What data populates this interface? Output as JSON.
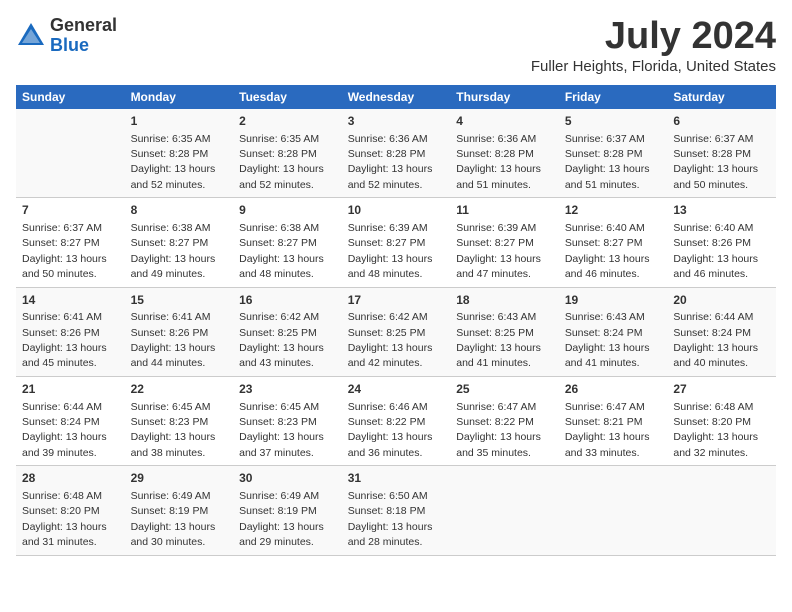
{
  "logo": {
    "general": "General",
    "blue": "Blue"
  },
  "title": "July 2024",
  "location": "Fuller Heights, Florida, United States",
  "days_header": [
    "Sunday",
    "Monday",
    "Tuesday",
    "Wednesday",
    "Thursday",
    "Friday",
    "Saturday"
  ],
  "weeks": [
    [
      {
        "num": "",
        "sunrise": "",
        "sunset": "",
        "daylight": ""
      },
      {
        "num": "1",
        "sunrise": "Sunrise: 6:35 AM",
        "sunset": "Sunset: 8:28 PM",
        "daylight": "Daylight: 13 hours and 52 minutes."
      },
      {
        "num": "2",
        "sunrise": "Sunrise: 6:35 AM",
        "sunset": "Sunset: 8:28 PM",
        "daylight": "Daylight: 13 hours and 52 minutes."
      },
      {
        "num": "3",
        "sunrise": "Sunrise: 6:36 AM",
        "sunset": "Sunset: 8:28 PM",
        "daylight": "Daylight: 13 hours and 52 minutes."
      },
      {
        "num": "4",
        "sunrise": "Sunrise: 6:36 AM",
        "sunset": "Sunset: 8:28 PM",
        "daylight": "Daylight: 13 hours and 51 minutes."
      },
      {
        "num": "5",
        "sunrise": "Sunrise: 6:37 AM",
        "sunset": "Sunset: 8:28 PM",
        "daylight": "Daylight: 13 hours and 51 minutes."
      },
      {
        "num": "6",
        "sunrise": "Sunrise: 6:37 AM",
        "sunset": "Sunset: 8:28 PM",
        "daylight": "Daylight: 13 hours and 50 minutes."
      }
    ],
    [
      {
        "num": "7",
        "sunrise": "Sunrise: 6:37 AM",
        "sunset": "Sunset: 8:27 PM",
        "daylight": "Daylight: 13 hours and 50 minutes."
      },
      {
        "num": "8",
        "sunrise": "Sunrise: 6:38 AM",
        "sunset": "Sunset: 8:27 PM",
        "daylight": "Daylight: 13 hours and 49 minutes."
      },
      {
        "num": "9",
        "sunrise": "Sunrise: 6:38 AM",
        "sunset": "Sunset: 8:27 PM",
        "daylight": "Daylight: 13 hours and 48 minutes."
      },
      {
        "num": "10",
        "sunrise": "Sunrise: 6:39 AM",
        "sunset": "Sunset: 8:27 PM",
        "daylight": "Daylight: 13 hours and 48 minutes."
      },
      {
        "num": "11",
        "sunrise": "Sunrise: 6:39 AM",
        "sunset": "Sunset: 8:27 PM",
        "daylight": "Daylight: 13 hours and 47 minutes."
      },
      {
        "num": "12",
        "sunrise": "Sunrise: 6:40 AM",
        "sunset": "Sunset: 8:27 PM",
        "daylight": "Daylight: 13 hours and 46 minutes."
      },
      {
        "num": "13",
        "sunrise": "Sunrise: 6:40 AM",
        "sunset": "Sunset: 8:26 PM",
        "daylight": "Daylight: 13 hours and 46 minutes."
      }
    ],
    [
      {
        "num": "14",
        "sunrise": "Sunrise: 6:41 AM",
        "sunset": "Sunset: 8:26 PM",
        "daylight": "Daylight: 13 hours and 45 minutes."
      },
      {
        "num": "15",
        "sunrise": "Sunrise: 6:41 AM",
        "sunset": "Sunset: 8:26 PM",
        "daylight": "Daylight: 13 hours and 44 minutes."
      },
      {
        "num": "16",
        "sunrise": "Sunrise: 6:42 AM",
        "sunset": "Sunset: 8:25 PM",
        "daylight": "Daylight: 13 hours and 43 minutes."
      },
      {
        "num": "17",
        "sunrise": "Sunrise: 6:42 AM",
        "sunset": "Sunset: 8:25 PM",
        "daylight": "Daylight: 13 hours and 42 minutes."
      },
      {
        "num": "18",
        "sunrise": "Sunrise: 6:43 AM",
        "sunset": "Sunset: 8:25 PM",
        "daylight": "Daylight: 13 hours and 41 minutes."
      },
      {
        "num": "19",
        "sunrise": "Sunrise: 6:43 AM",
        "sunset": "Sunset: 8:24 PM",
        "daylight": "Daylight: 13 hours and 41 minutes."
      },
      {
        "num": "20",
        "sunrise": "Sunrise: 6:44 AM",
        "sunset": "Sunset: 8:24 PM",
        "daylight": "Daylight: 13 hours and 40 minutes."
      }
    ],
    [
      {
        "num": "21",
        "sunrise": "Sunrise: 6:44 AM",
        "sunset": "Sunset: 8:24 PM",
        "daylight": "Daylight: 13 hours and 39 minutes."
      },
      {
        "num": "22",
        "sunrise": "Sunrise: 6:45 AM",
        "sunset": "Sunset: 8:23 PM",
        "daylight": "Daylight: 13 hours and 38 minutes."
      },
      {
        "num": "23",
        "sunrise": "Sunrise: 6:45 AM",
        "sunset": "Sunset: 8:23 PM",
        "daylight": "Daylight: 13 hours and 37 minutes."
      },
      {
        "num": "24",
        "sunrise": "Sunrise: 6:46 AM",
        "sunset": "Sunset: 8:22 PM",
        "daylight": "Daylight: 13 hours and 36 minutes."
      },
      {
        "num": "25",
        "sunrise": "Sunrise: 6:47 AM",
        "sunset": "Sunset: 8:22 PM",
        "daylight": "Daylight: 13 hours and 35 minutes."
      },
      {
        "num": "26",
        "sunrise": "Sunrise: 6:47 AM",
        "sunset": "Sunset: 8:21 PM",
        "daylight": "Daylight: 13 hours and 33 minutes."
      },
      {
        "num": "27",
        "sunrise": "Sunrise: 6:48 AM",
        "sunset": "Sunset: 8:20 PM",
        "daylight": "Daylight: 13 hours and 32 minutes."
      }
    ],
    [
      {
        "num": "28",
        "sunrise": "Sunrise: 6:48 AM",
        "sunset": "Sunset: 8:20 PM",
        "daylight": "Daylight: 13 hours and 31 minutes."
      },
      {
        "num": "29",
        "sunrise": "Sunrise: 6:49 AM",
        "sunset": "Sunset: 8:19 PM",
        "daylight": "Daylight: 13 hours and 30 minutes."
      },
      {
        "num": "30",
        "sunrise": "Sunrise: 6:49 AM",
        "sunset": "Sunset: 8:19 PM",
        "daylight": "Daylight: 13 hours and 29 minutes."
      },
      {
        "num": "31",
        "sunrise": "Sunrise: 6:50 AM",
        "sunset": "Sunset: 8:18 PM",
        "daylight": "Daylight: 13 hours and 28 minutes."
      },
      {
        "num": "",
        "sunrise": "",
        "sunset": "",
        "daylight": ""
      },
      {
        "num": "",
        "sunrise": "",
        "sunset": "",
        "daylight": ""
      },
      {
        "num": "",
        "sunrise": "",
        "sunset": "",
        "daylight": ""
      }
    ]
  ]
}
